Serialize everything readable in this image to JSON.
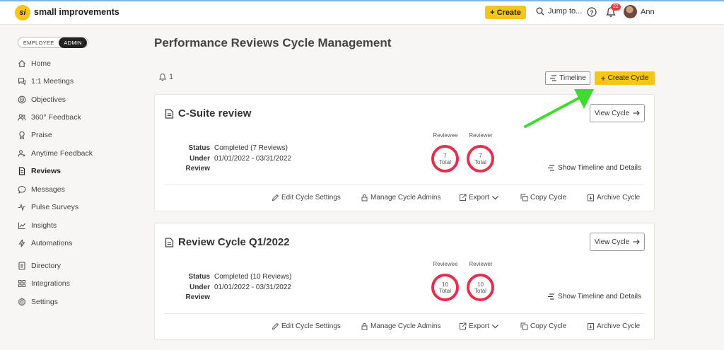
{
  "topbar": {
    "logo_glyph": "si",
    "brand": "small improvements",
    "create_label": "Create",
    "jump_label": "Jump to...",
    "notification_badge": "22",
    "user_name": "Ann"
  },
  "sidebar": {
    "role_employee": "EMPLOYEE",
    "role_admin": "ADMIN",
    "items": [
      {
        "label": "Home",
        "icon": "home-icon"
      },
      {
        "label": "1:1 Meetings",
        "icon": "chat-icon"
      },
      {
        "label": "Objectives",
        "icon": "target-icon"
      },
      {
        "label": "360° Feedback",
        "icon": "people-icon"
      },
      {
        "label": "Praise",
        "icon": "award-icon"
      },
      {
        "label": "Anytime Feedback",
        "icon": "person-star-icon"
      },
      {
        "label": "Reviews",
        "icon": "document-icon",
        "active": true
      },
      {
        "label": "Messages",
        "icon": "message-icon"
      },
      {
        "label": "Pulse Surveys",
        "icon": "pulse-icon"
      },
      {
        "label": "Insights",
        "icon": "chart-icon"
      },
      {
        "label": "Automations",
        "icon": "bolt-icon"
      },
      {
        "label": "Directory",
        "icon": "directory-icon"
      },
      {
        "label": "Integrations",
        "icon": "grid-icon"
      },
      {
        "label": "Settings",
        "icon": "gear-icon"
      }
    ]
  },
  "main": {
    "title": "Performance Reviews Cycle Management",
    "notification_count": "1",
    "timeline_label": "Timeline",
    "create_cycle_label": "Create Cycle",
    "cards": [
      {
        "title": "C-Suite review",
        "view_label": "View Cycle",
        "status_label": "Status",
        "status_value": "Completed (7 Reviews)",
        "under_review_label": "Under Review",
        "under_review_value": "01/01/2022 - 03/31/2022",
        "reviewee_label": "Reviewee",
        "reviewer_label": "Reviewer",
        "reviewee_count": "7",
        "reviewer_count": "7",
        "total_label": "Total",
        "show_timeline_label": "Show Timeline and Details",
        "actions": [
          "Edit Cycle Settings",
          "Manage Cycle Admins",
          "Export",
          "Copy Cycle",
          "Archive Cycle"
        ]
      },
      {
        "title": "Review Cycle Q1/2022",
        "view_label": "View Cycle",
        "status_label": "Status",
        "status_value": "Completed (10 Reviews)",
        "under_review_label": "Under Review",
        "under_review_value": "01/01/2022 - 03/31/2022",
        "reviewee_label": "Reviewee",
        "reviewer_label": "Reviewer",
        "reviewee_count": "10",
        "reviewer_count": "10",
        "total_label": "Total",
        "show_timeline_label": "Show Timeline and Details",
        "actions": [
          "Edit Cycle Settings",
          "Manage Cycle Admins",
          "Export",
          "Copy Cycle",
          "Archive Cycle"
        ]
      }
    ]
  },
  "colors": {
    "accent_yellow": "#f5c518",
    "ring_red": "#e62e4d",
    "annotation_green": "#3ddc2e",
    "badge_red": "#e03a3a"
  }
}
